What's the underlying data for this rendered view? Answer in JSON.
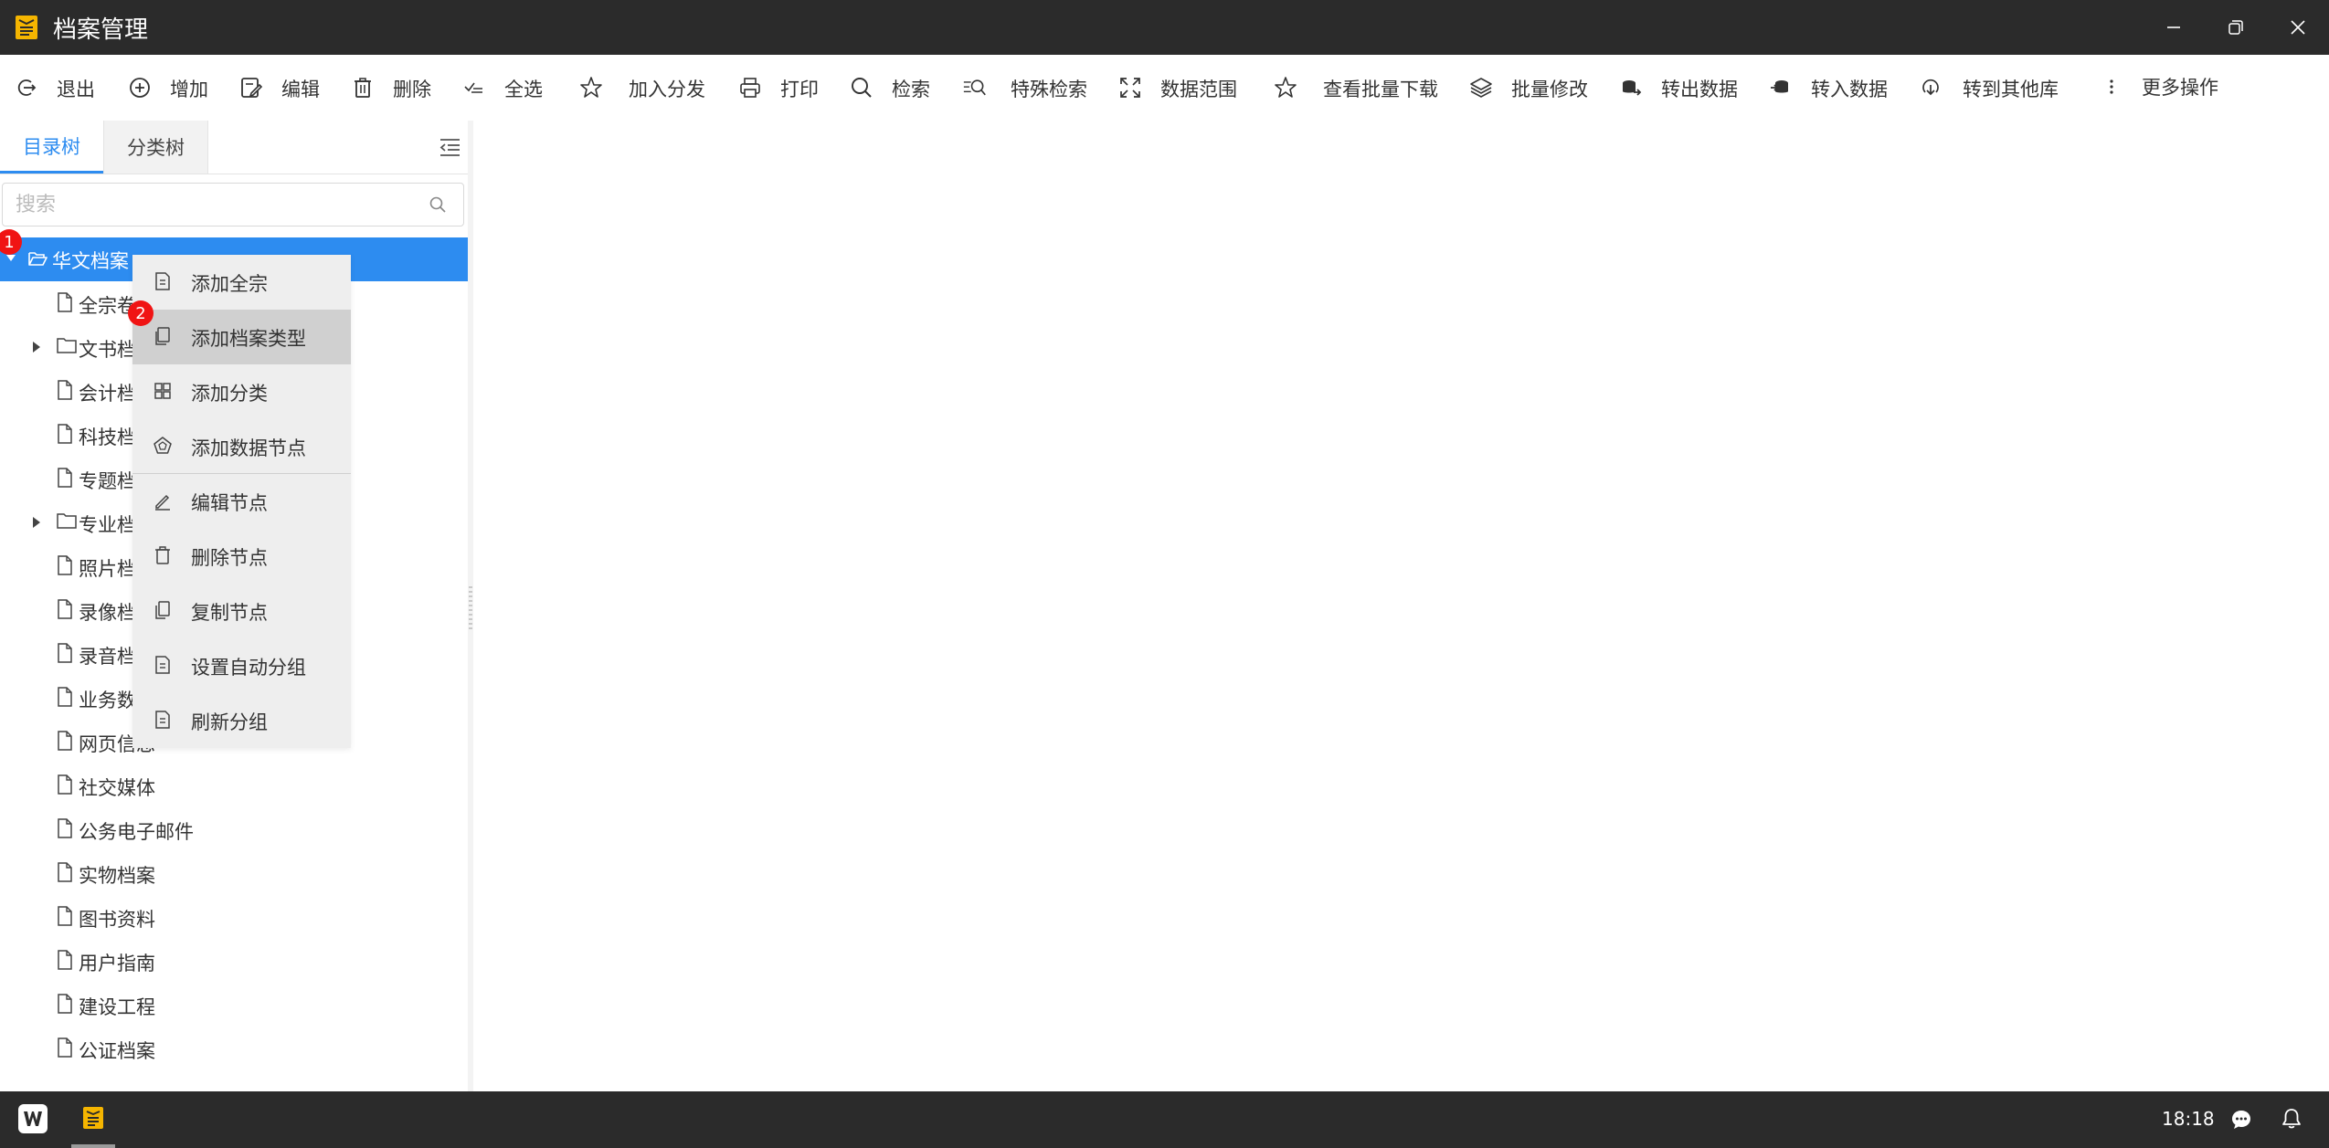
{
  "window": {
    "title": "档案管理",
    "accent": "#2d8cf0",
    "titlebar_color": "#2b2b2b",
    "logo_color": "#f5b500"
  },
  "toolbar": {
    "items": [
      {
        "id": "exit",
        "label": "退出",
        "icon": "logout-icon"
      },
      {
        "id": "add",
        "label": "增加",
        "icon": "plus-circle-icon"
      },
      {
        "id": "edit",
        "label": "编辑",
        "icon": "edit-icon"
      },
      {
        "id": "delete",
        "label": "删除",
        "icon": "trash-icon"
      },
      {
        "id": "select-all",
        "label": "全选",
        "icon": "select-all-icon"
      },
      {
        "id": "add-distribute",
        "label": "加入分发",
        "icon": "star-icon"
      },
      {
        "id": "print",
        "label": "打印",
        "icon": "printer-icon"
      },
      {
        "id": "search",
        "label": "检索",
        "icon": "search-icon"
      },
      {
        "id": "special-search",
        "label": "特殊检索",
        "icon": "list-search-icon"
      },
      {
        "id": "data-range",
        "label": "数据范围",
        "icon": "expand-icon"
      },
      {
        "id": "batch-download",
        "label": "查看批量下载",
        "icon": "star-icon"
      },
      {
        "id": "batch-modify",
        "label": "批量修改",
        "icon": "layers-icon"
      },
      {
        "id": "export-data",
        "label": "转出数据",
        "icon": "database-out-icon"
      },
      {
        "id": "import-data",
        "label": "转入数据",
        "icon": "database-in-icon"
      },
      {
        "id": "transfer-other",
        "label": "转到其他库",
        "icon": "transfer-icon"
      },
      {
        "id": "more",
        "label": "更多操作",
        "icon": "more-vertical-icon"
      }
    ]
  },
  "left_panel": {
    "tabs": [
      {
        "label": "目录树",
        "active": true
      },
      {
        "label": "分类树",
        "active": false
      }
    ],
    "search": {
      "placeholder": "搜索",
      "value": ""
    },
    "tree": {
      "root": {
        "label": "华文档案",
        "badge": "1",
        "expanded": true
      },
      "children": [
        {
          "label": "全宗卷",
          "expandable": false
        },
        {
          "label": "文书档案",
          "expandable": true
        },
        {
          "label": "会计档案",
          "expandable": false
        },
        {
          "label": "科技档案",
          "expandable": false
        },
        {
          "label": "专题档案",
          "expandable": false
        },
        {
          "label": "专业档案",
          "expandable": true
        },
        {
          "label": "照片档案",
          "expandable": false
        },
        {
          "label": "录像档案",
          "expandable": false
        },
        {
          "label": "录音档案",
          "expandable": false
        },
        {
          "label": "业务数据",
          "expandable": false
        },
        {
          "label": "网页信息",
          "expandable": false
        },
        {
          "label": "社交媒体",
          "expandable": false
        },
        {
          "label": "公务电子邮件",
          "expandable": false
        },
        {
          "label": "实物档案",
          "expandable": false
        },
        {
          "label": "图书资料",
          "expandable": false
        },
        {
          "label": "用户指南",
          "expandable": false
        },
        {
          "label": "建设工程",
          "expandable": false
        },
        {
          "label": "公证档案",
          "expandable": false
        }
      ]
    }
  },
  "context_menu": {
    "badge": "2",
    "items": [
      {
        "label": "添加全宗",
        "icon": "document-icon"
      },
      {
        "label": "添加档案类型",
        "icon": "copy-doc-icon",
        "hovered": true
      },
      {
        "label": "添加分类",
        "icon": "grid-icon"
      },
      {
        "label": "添加数据节点",
        "icon": "pentagon-icon"
      },
      {
        "label": "编辑节点",
        "icon": "pencil-icon"
      },
      {
        "label": "删除节点",
        "icon": "trash-icon"
      },
      {
        "label": "复制节点",
        "icon": "copy-icon"
      },
      {
        "label": "设置自动分组",
        "icon": "document-icon"
      },
      {
        "label": "刷新分组",
        "icon": "document-icon"
      }
    ]
  },
  "taskbar": {
    "time": "18:18"
  }
}
